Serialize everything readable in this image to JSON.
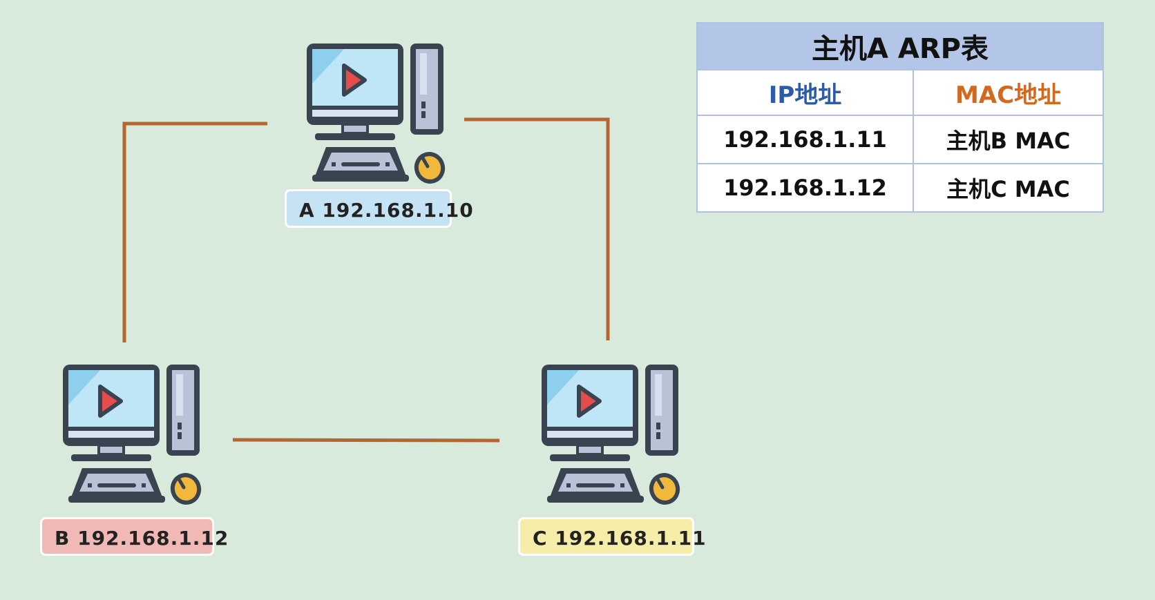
{
  "colors": {
    "background": "#d8eadc",
    "link": "#b5652f",
    "host_a_label_bg": "#c5e3f4",
    "host_b_label_bg": "#f1b9b6",
    "host_c_label_bg": "#f6eda8",
    "table_header_bg": "#b3c6e8",
    "ip_header": "#2e5ba8",
    "mac_header": "#d2691e"
  },
  "hosts": {
    "a": {
      "label": "A 192.168.1.10",
      "icon": "desktop-computer-icon"
    },
    "b": {
      "label": "B 192.168.1.12",
      "icon": "desktop-computer-icon"
    },
    "c": {
      "label": "C 192.168.1.11",
      "icon": "desktop-computer-icon"
    }
  },
  "arp_table": {
    "title": "主机A ARP表",
    "headers": {
      "ip": "IP地址",
      "mac": "MAC地址"
    },
    "rows": [
      {
        "ip": "192.168.1.11",
        "mac": "主机B MAC"
      },
      {
        "ip": "192.168.1.12",
        "mac": "主机C MAC"
      }
    ]
  }
}
